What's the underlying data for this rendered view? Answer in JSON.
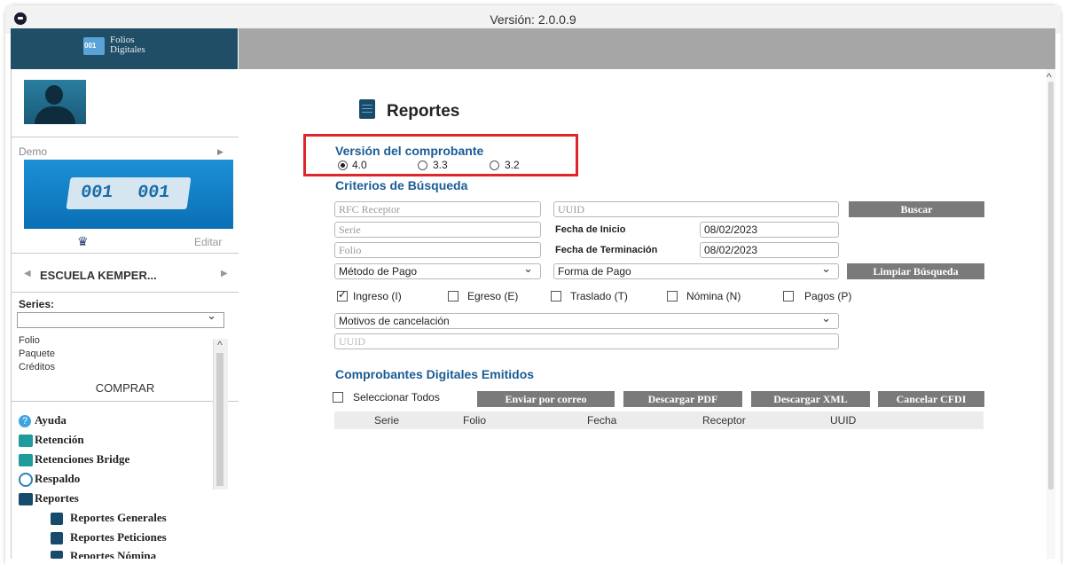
{
  "window": {
    "version": "Versión: 2.0.0.9"
  },
  "brand": {
    "logo_line1": "Folios",
    "logo_line2": "Digitales"
  },
  "sidebar": {
    "account_label": "Demo",
    "banner_text_left": "001",
    "banner_text_right": "001",
    "edit_label": "Editar",
    "school_name": "ESCUELA KEMPER...",
    "series_label": "Series:",
    "folio_label": "Folio",
    "package_label": "Paquete",
    "credits_label": "Créditos",
    "buy_label": "COMPRAR",
    "menu": [
      {
        "label": "Ayuda",
        "icon": "help-icon"
      },
      {
        "label": "Retención",
        "icon": "retention-icon"
      },
      {
        "label": "Retenciones Bridge",
        "icon": "retention-bridge-icon"
      },
      {
        "label": "Respaldo",
        "icon": "backup-icon"
      },
      {
        "label": "Reportes",
        "icon": "reports-icon"
      },
      {
        "label": "Reportes Generales",
        "icon": "report-icon"
      },
      {
        "label": "Reportes Peticiones",
        "icon": "report-icon"
      },
      {
        "label": "Reportes Nómina",
        "icon": "report-icon"
      }
    ]
  },
  "main": {
    "title": "Reportes",
    "version_section": {
      "title": "Versión del comprobante",
      "options": [
        "4.0",
        "3.3",
        "3.2"
      ],
      "selected": "4.0"
    },
    "search": {
      "title": "Criterios de Búsqueda",
      "rfc_placeholder": "RFC Receptor",
      "uuid_placeholder": "UUID",
      "serie_placeholder": "Serie",
      "folio_placeholder": "Folio",
      "start_label": "Fecha de Inicio",
      "start_value": "08/02/2023",
      "end_label": "Fecha de Terminación",
      "end_value": "08/02/2023",
      "payment_method": "Método de Pago",
      "payment_form": "Forma de Pago",
      "search_button": "Buscar",
      "clear_button": "Limpiar Búsqueda",
      "types": [
        {
          "label": "Ingreso (I)",
          "checked": true
        },
        {
          "label": "Egreso (E)",
          "checked": false
        },
        {
          "label": "Traslado (T)",
          "checked": false
        },
        {
          "label": "Nómina (N)",
          "checked": false
        },
        {
          "label": "Pagos (P)",
          "checked": false
        }
      ],
      "cancel_reason": "Motivos de cancelación",
      "uuid2_placeholder": "UUID"
    },
    "issued": {
      "title": "Comprobantes Digitales Emitidos",
      "select_all": "Seleccionar Todos",
      "send_email": "Enviar por correo",
      "download_pdf": "Descargar PDF",
      "download_xml": "Descargar XML",
      "cancel_cfdi": "Cancelar CFDI",
      "columns": [
        "Serie",
        "Folio",
        "Fecha",
        "Receptor",
        "UUID"
      ]
    }
  }
}
